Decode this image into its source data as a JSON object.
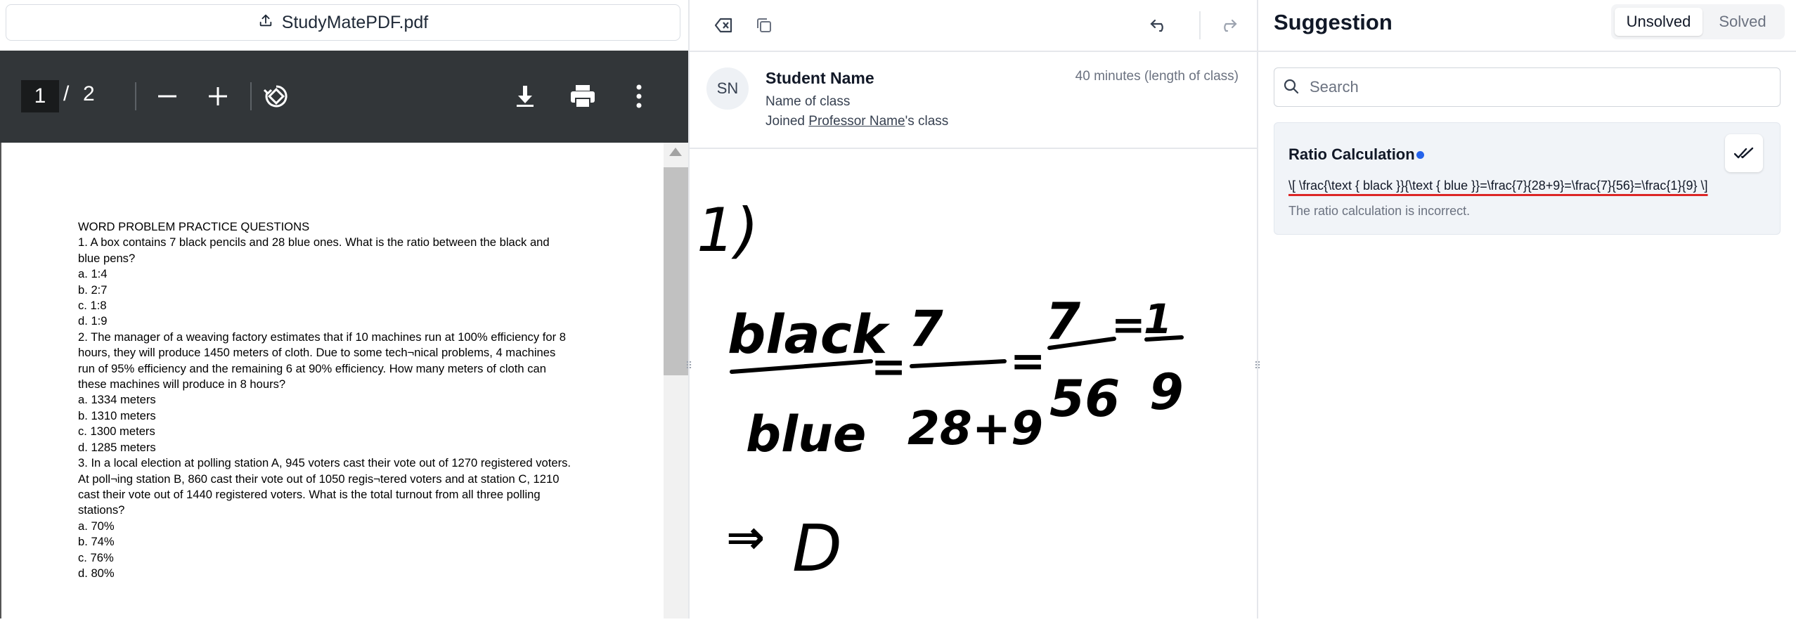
{
  "pdf": {
    "filename": "StudyMatePDF.pdf",
    "current_page": "1",
    "separator": "/",
    "total_pages": "2",
    "lines": [
      "WORD PROBLEM PRACTICE QUESTIONS",
      "1. A box contains 7 black pencils and 28 blue ones. What is the ratio between the black and",
      "blue pens?",
      "a. 1:4",
      "b. 2:7",
      "c. 1:8",
      "d. 1:9",
      "2. The manager of a weaving factory estimates that if 10 machines run at 100% efficiency for 8",
      "hours, they will produce 1450 meters of cloth. Due to some tech¬nical problems, 4 machines",
      "run of 95% efficiency and the remaining 6 at 90% efficiency. How many meters of cloth can",
      "these machines will produce in 8 hours?",
      "a. 1334 meters",
      "b. 1310 meters",
      "c. 1300 meters",
      "d. 1285 meters",
      "3. In a local election at polling station A, 945 voters cast their vote out of 1270 registered voters.",
      "At poll¬ing station B, 860 cast their vote out of 1050 regis¬tered voters and at station C, 1210",
      "cast their vote out of 1440 registered voters. What is the total turnout from all three polling",
      "stations?",
      "a. 70%",
      "b. 74%",
      "c. 76%",
      "d. 80%"
    ]
  },
  "student": {
    "initials": "SN",
    "name": "Student Name",
    "class_name": "Name of class",
    "joined_prefix": "Joined ",
    "professor": "Professor Name",
    "joined_suffix": "'s class",
    "duration": "40 minutes (length of class)"
  },
  "handwriting": {
    "question_number": "1)",
    "numerator_word": "black",
    "denominator_word": "blue",
    "eq": "=",
    "n1": "7",
    "d1": "28+9",
    "n2": "7",
    "d2": "56",
    "n3": "1",
    "d3": "9",
    "answer_arrow": "⇒",
    "answer": "D"
  },
  "suggestion": {
    "title": "Suggestion",
    "tab_unsolved": "Unsolved",
    "tab_solved": "Solved",
    "search_placeholder": "Search",
    "card_title": "Ratio Calculation",
    "card_formula": "\\[ \\frac{\\text { black }}{\\text { blue }}=\\frac{7}{28+9}=\\frac{7}{56}=\\frac{1}{9} \\]",
    "card_description": "The ratio calculation is incorrect.",
    "accent_color": "#2563eb",
    "error_color": "#dc2626"
  }
}
